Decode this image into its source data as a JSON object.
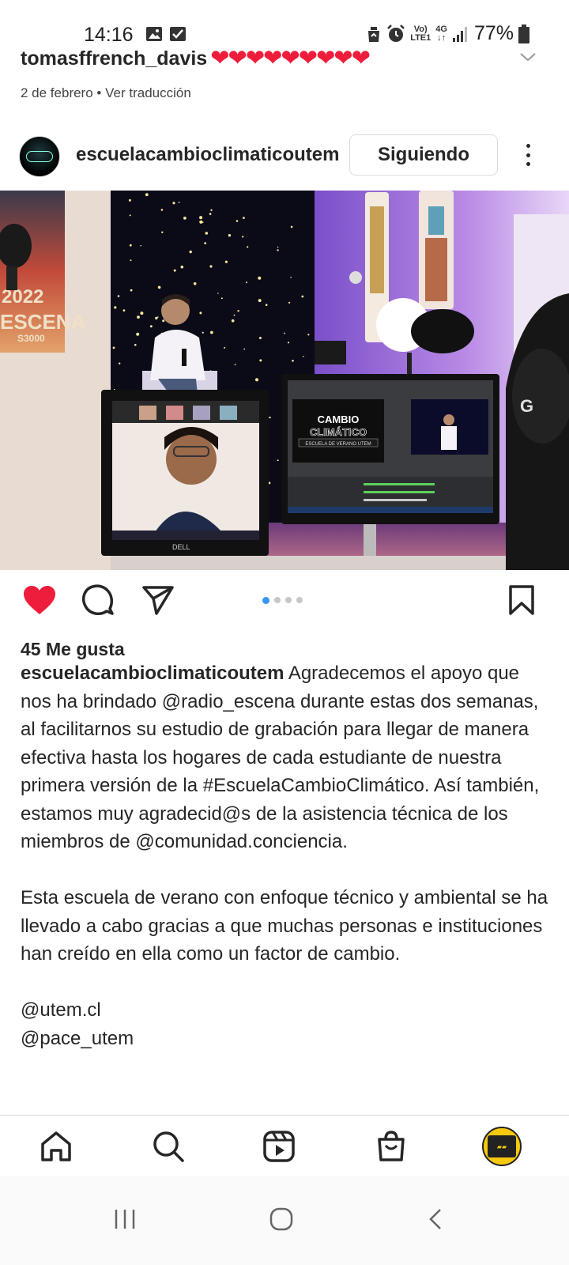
{
  "status_bar": {
    "time": "14:16",
    "network_top": "Vo)",
    "network_bottom": "LTE1",
    "net_type": "4G",
    "battery": "77%"
  },
  "previous_comment": {
    "username": "tomasffrench_davis",
    "heart_count": 9,
    "date": "2 de febrero",
    "separator": "•",
    "translate": "Ver traducción"
  },
  "post": {
    "account": "escuelacambioclimaticoutem",
    "follow_label": "Siguiendo",
    "carousel": {
      "count": 4,
      "active": 1
    },
    "likes": "45 Me gusta",
    "caption": {
      "username": "escuelacambioclimaticoutem",
      "paragraph1": "Agradecemos el apoyo que nos ha brindado @radio_escena durante estas dos semanas, al facilitarnos su estudio de grabación para llegar de manera efectiva hasta los hogares de cada estudiante de nuestra primera versión de la #EscuelaCambioClimático. Así también, estamos muy agradecid@s de la asistencia técnica de los miembros de @comunidad.conciencia.",
      "paragraph2": "Esta escuela de verano con enfoque técnico y ambiental se ha llevado a cabo gracias a que muchas personas e instituciones han creído en ella como un factor de cambio.",
      "mention1": "@utem.cl",
      "mention2": "@pace_utem"
    },
    "image": {
      "poster_year": "2022",
      "poster_name": "ESCENA",
      "poster_freq": "S3000",
      "screen_title1": "CAMBIO",
      "screen_title2": "CLIMÁTICO",
      "screen_subtitle": "ESCUELA DE VERANO UTEM",
      "monitor_brand": "DELL"
    }
  },
  "colors": {
    "heart": "#ee1d3b",
    "text": "#262626",
    "dot_active": "#3897f0"
  }
}
